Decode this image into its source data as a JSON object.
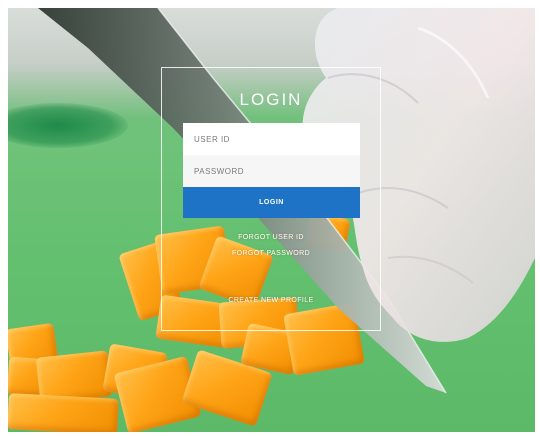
{
  "login": {
    "title": "LOGIN",
    "user_id_placeholder": "USER ID",
    "password_placeholder": "PASSWORD",
    "login_button_label": "LOGIN",
    "forgot_user_id_label": "FORGOT USER ID",
    "forgot_password_label": "FORGOT PASSWORD",
    "create_profile_label": "CREATE NEW PROFILE",
    "button_color": "#1f73c7"
  }
}
